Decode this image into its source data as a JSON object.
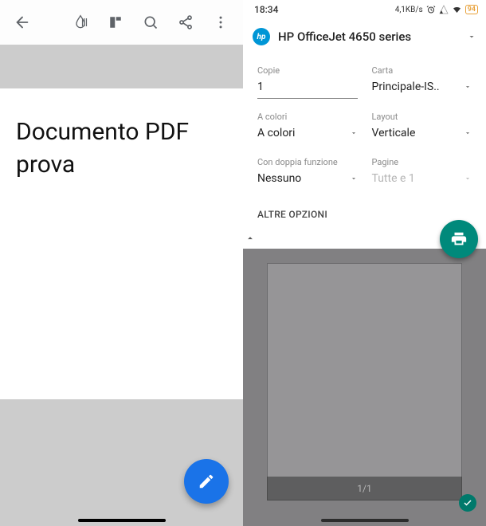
{
  "left": {
    "document_text": "Documento PDF prova"
  },
  "right": {
    "status": {
      "time": "18:34",
      "net_speed": "4,1KB/s",
      "battery_pct": "94"
    },
    "printer": {
      "brand": "hp",
      "name": "HP OfficeJet 4650 series"
    },
    "options": {
      "copies_label": "Copie",
      "copies_value": "1",
      "paper_label": "Carta",
      "paper_value": "Principale-IS..",
      "color_label": "A colori",
      "color_value": "A colori",
      "layout_label": "Layout",
      "layout_value": "Verticale",
      "duplex_label": "Con doppia funzione",
      "duplex_value": "Nessuno",
      "pages_label": "Pagine",
      "pages_value": "Tutte e 1"
    },
    "more_options": "ALTRE OPZIONI",
    "page_counter": "1/1"
  }
}
